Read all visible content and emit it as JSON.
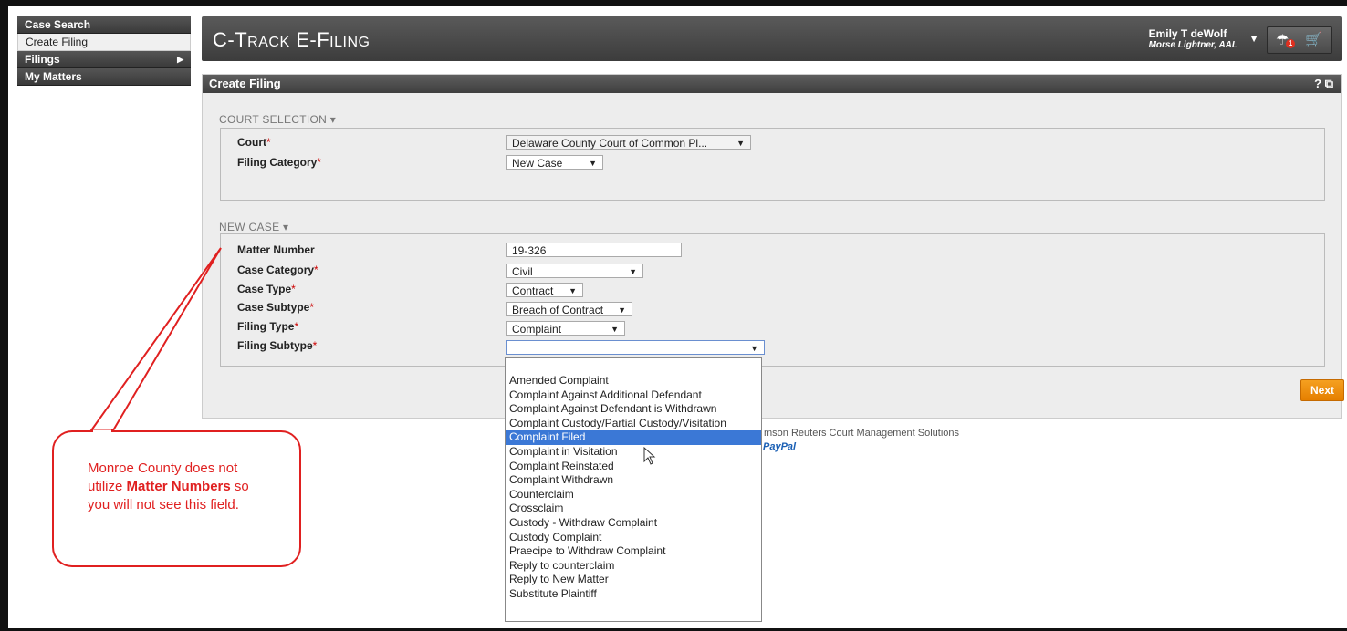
{
  "nav": {
    "items": [
      {
        "label": "Case Search"
      },
      {
        "label": "Create Filing"
      },
      {
        "label": "Filings"
      },
      {
        "label": "My Matters"
      }
    ]
  },
  "header": {
    "title_big1": "C-T",
    "title_small1": "RACK",
    "title_big2": " E-F",
    "title_small2": "ILING",
    "user_name": "Emily T deWolf",
    "user_firm": "Morse Lightner, AAL",
    "badge_count": "1"
  },
  "panel": {
    "title": "Create Filing",
    "tools": "? ⧉",
    "court_section": {
      "title": "COURT SELECTION ▾",
      "court_label": "Court",
      "court_value": "Delaware County Court of Common Pl...",
      "filing_category_label": "Filing Category",
      "filing_category_value": "New Case"
    },
    "new_case_section": {
      "title": "NEW CASE ▾",
      "matter_number_label": "Matter Number",
      "matter_number_value": "19-326",
      "case_category_label": "Case Category",
      "case_category_value": "Civil",
      "case_type_label": "Case Type",
      "case_type_value": "Contract",
      "case_subtype_label": "Case Subtype",
      "case_subtype_value": "Breach of Contract",
      "filing_type_label": "Filing Type",
      "filing_type_value": "Complaint",
      "filing_subtype_label": "Filing Subtype",
      "filing_subtype_value": ""
    },
    "next_label": "Next"
  },
  "footer": {
    "text": "mson Reuters Court Management Solutions",
    "paypal": "PayPal"
  },
  "dropdown": {
    "options": [
      "",
      "Amended Complaint",
      "Complaint Against Additional Defendant",
      "Complaint Against Defendant is Withdrawn",
      "Complaint Custody/Partial Custody/Visitation",
      "Complaint Filed",
      "Complaint in Visitation",
      "Complaint Reinstated",
      "Complaint Withdrawn",
      "Counterclaim",
      "Crossclaim",
      "Custody - Withdraw Complaint",
      "Custody Complaint",
      "Praecipe to Withdraw Complaint",
      "Reply to counterclaim",
      "Reply to New Matter",
      "Substitute Plaintiff"
    ],
    "highlighted": "Complaint Filed"
  },
  "callout": {
    "text_1": "Monroe County does not utilize ",
    "text_bold": "Matter Numbers",
    "text_2": " so you will not see this field."
  },
  "colors": {
    "header_bg": "#3c3c3c",
    "accent_orange": "#f08c10",
    "highlight_blue": "#3b78d6",
    "callout_red": "#e02020",
    "required_red": "#cc0000"
  }
}
